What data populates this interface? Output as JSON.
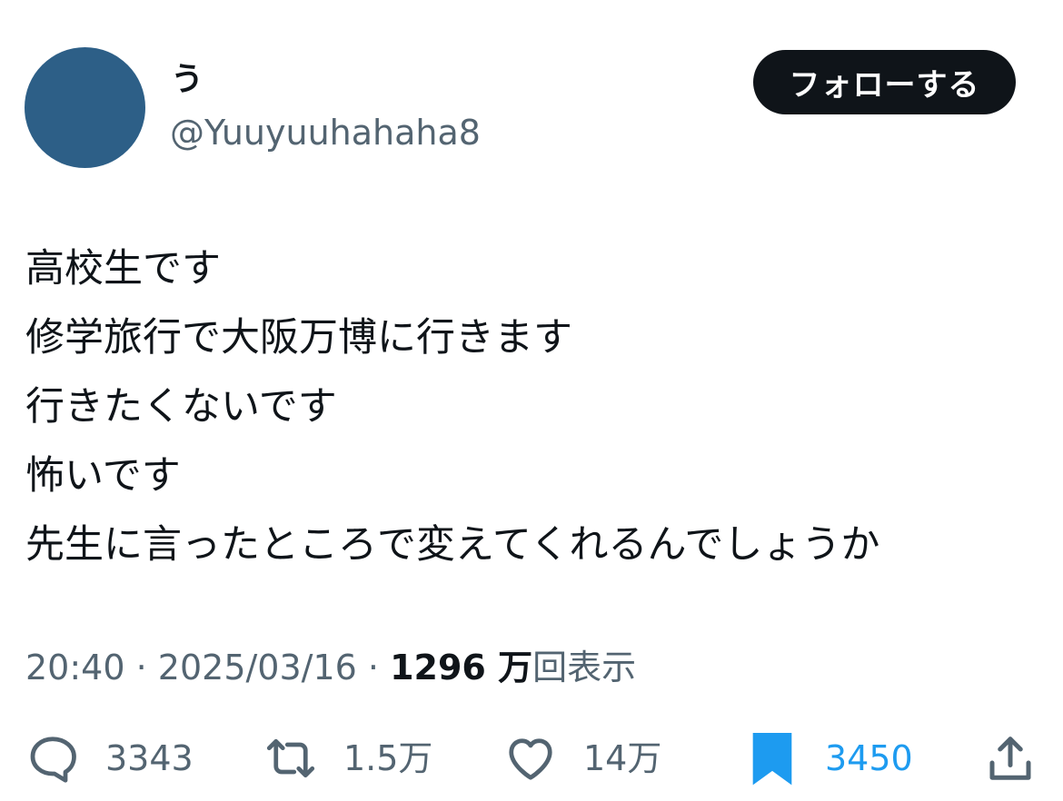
{
  "user": {
    "display_name": "う",
    "handle": "@Yuuyuuhahaha8",
    "follow_label": "フォローする"
  },
  "tweet": {
    "lines": [
      "高校生です",
      "修学旅行で大阪万博に行きます",
      "行きたくないです",
      "怖いです",
      "先生に言ったところで変えてくれるんでしょうか"
    ]
  },
  "meta": {
    "time": "20:40",
    "separator": "·",
    "date": "2025/03/16",
    "views_count": "1296 万",
    "views_label": "回表示"
  },
  "actions": {
    "reply": {
      "icon": "reply-icon",
      "count": "3343"
    },
    "retweet": {
      "icon": "retweet-icon",
      "count": "1.5万"
    },
    "like": {
      "icon": "heart-icon",
      "count": "14万"
    },
    "bookmark": {
      "icon": "bookmark-icon",
      "count": "3450",
      "active": true
    },
    "share": {
      "icon": "share-icon"
    }
  },
  "colors": {
    "avatar": "#2d5f87",
    "text_primary": "#0f1419",
    "text_secondary": "#536471",
    "accent_blue": "#1d9bf0",
    "follow_button_bg": "#0f1419"
  }
}
